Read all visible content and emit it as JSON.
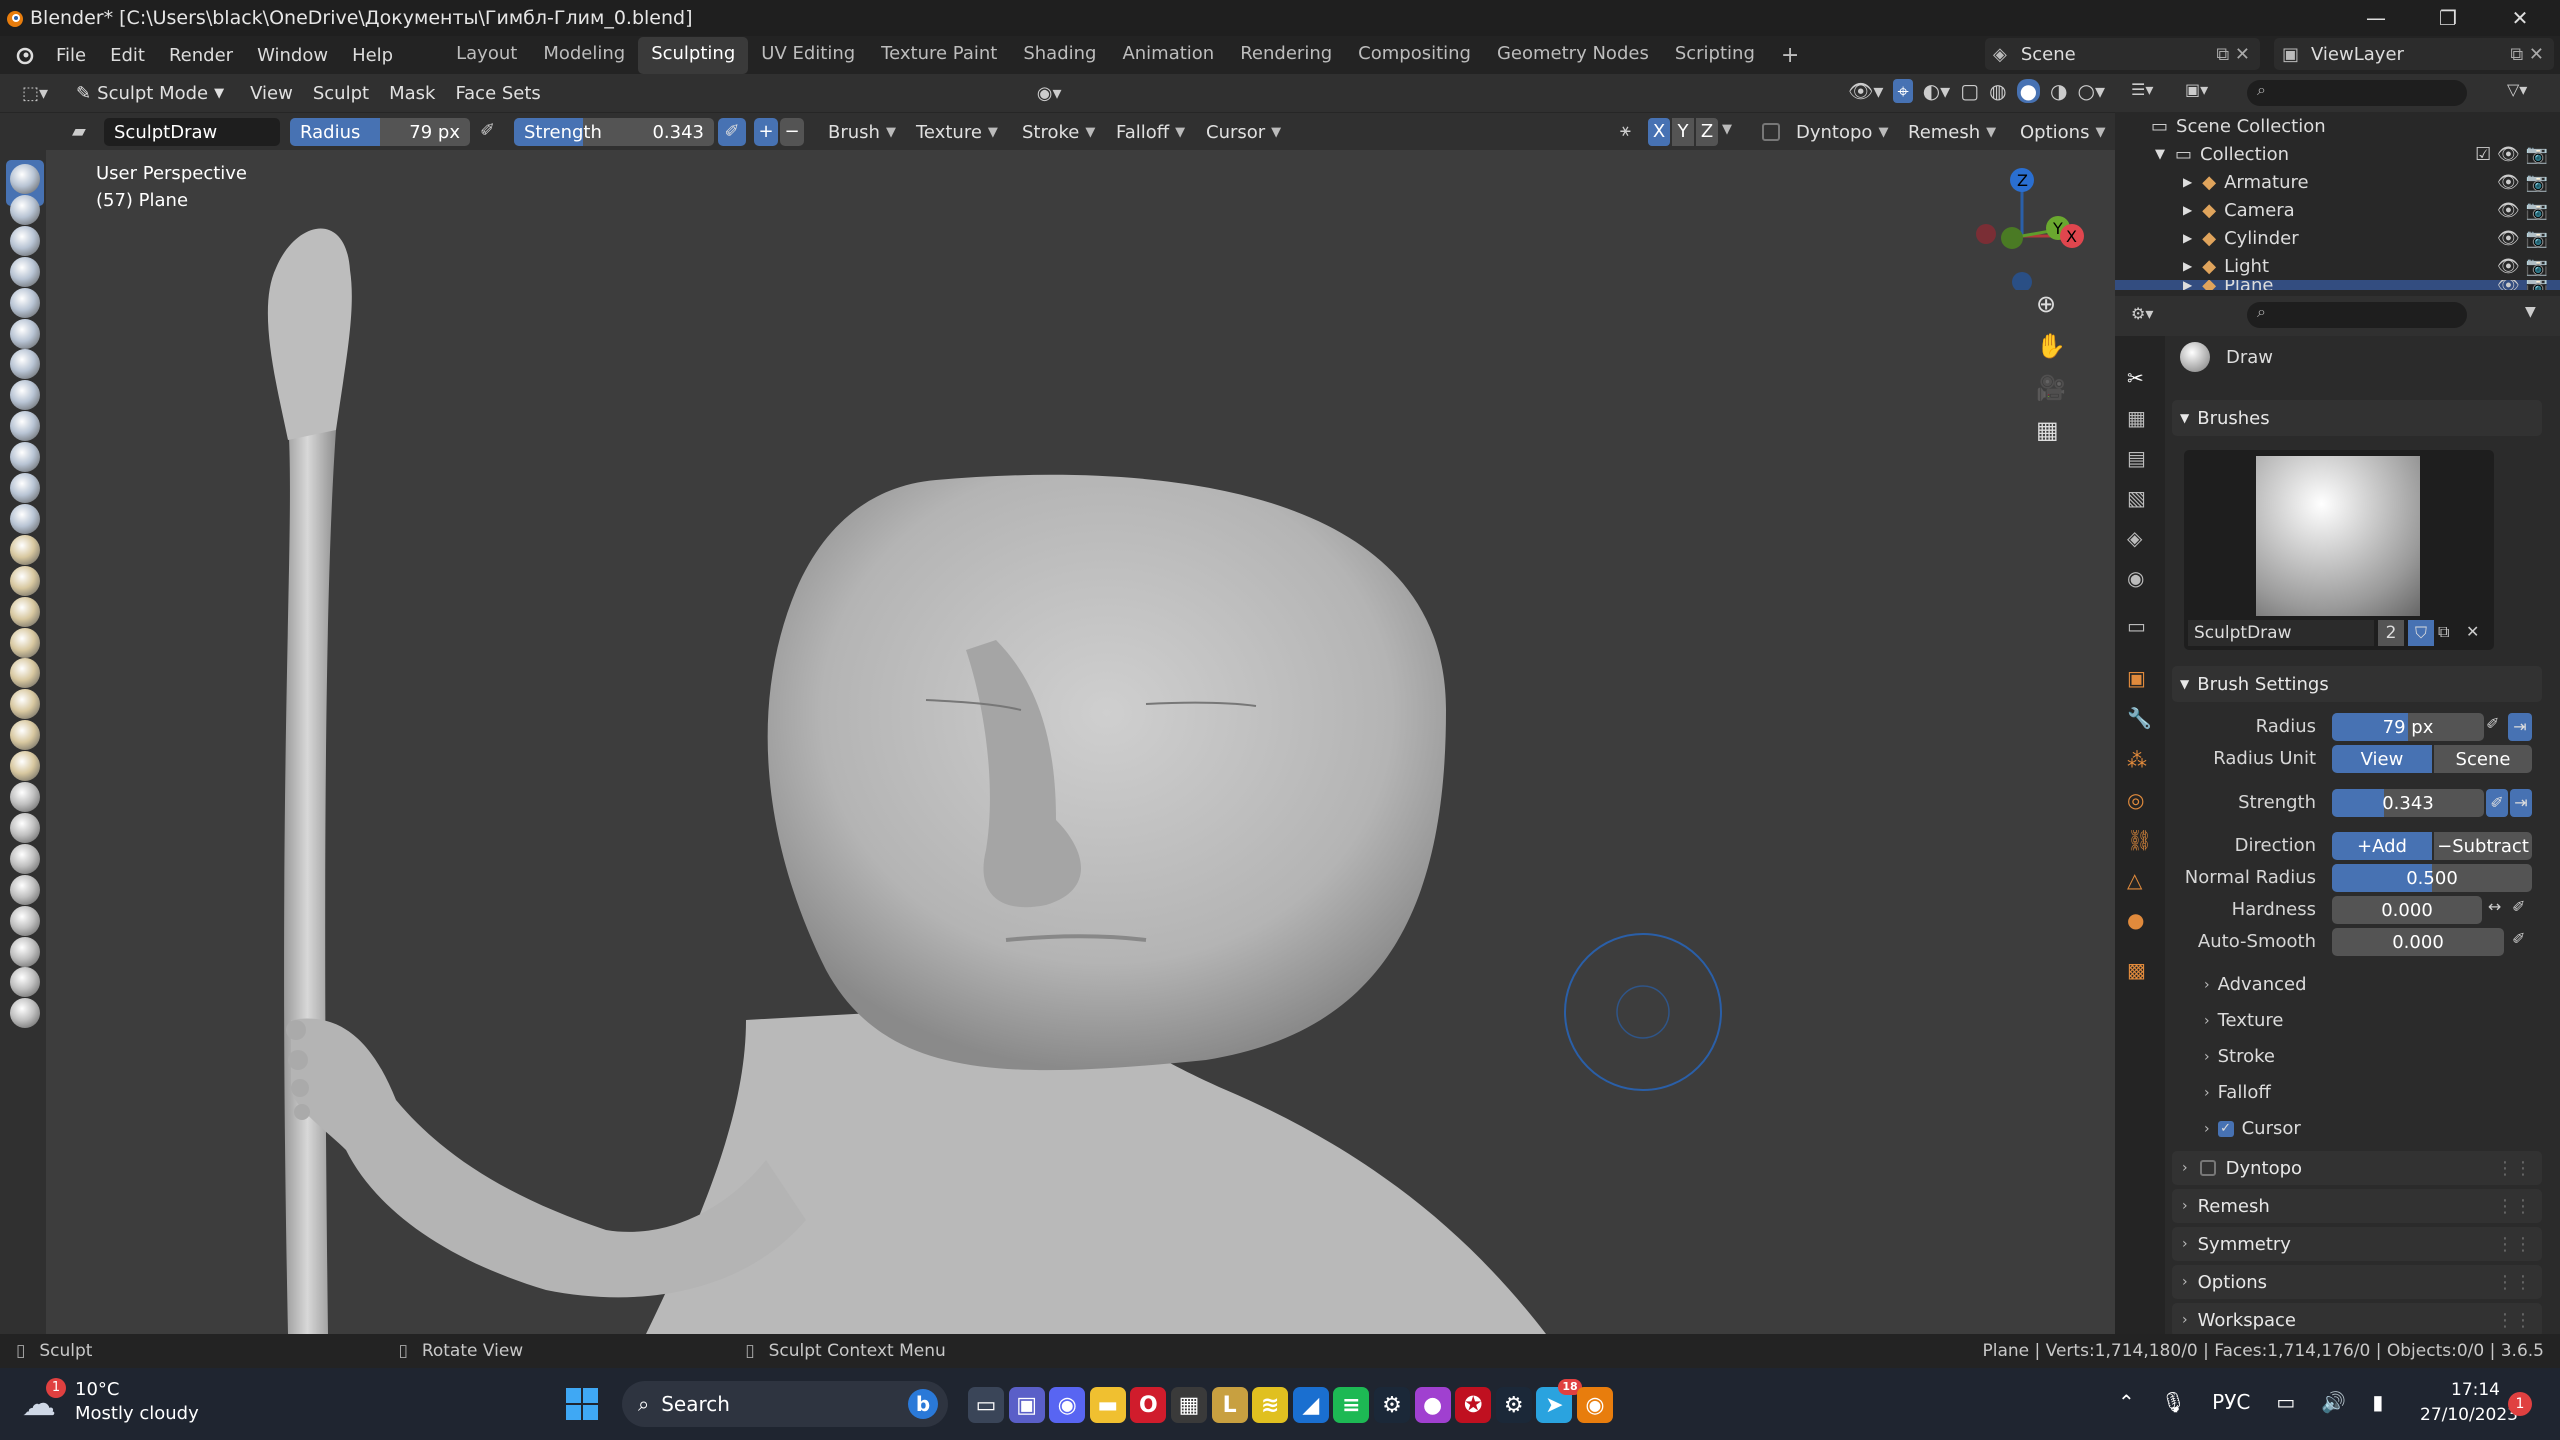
{
  "window": {
    "title": "Blender* [C:\\Users\\black\\OneDrive\\Документы\\Гимбл-Глим_0.blend]",
    "minimize": "—",
    "maximize": "❐",
    "close": "✕"
  },
  "menu": [
    "File",
    "Edit",
    "Render",
    "Window",
    "Help"
  ],
  "workspaces": [
    {
      "label": "Layout"
    },
    {
      "label": "Modeling"
    },
    {
      "label": "Sculpting",
      "active": true
    },
    {
      "label": "UV Editing"
    },
    {
      "label": "Texture Paint"
    },
    {
      "label": "Shading"
    },
    {
      "label": "Animation"
    },
    {
      "label": "Rendering"
    },
    {
      "label": "Compositing"
    },
    {
      "label": "Geometry Nodes"
    },
    {
      "label": "Scripting"
    }
  ],
  "add_workspace": "+",
  "scene": "Scene",
  "view_layer": "ViewLayer",
  "viewport_header": {
    "mode": "Sculpt Mode",
    "menus": [
      "View",
      "Sculpt",
      "Mask",
      "Face Sets"
    ]
  },
  "tool_header": {
    "brush_name": "SculptDraw",
    "radius_label": "Radius",
    "radius_value": "79 px",
    "radius_fill": 0.5,
    "strength_label": "Strength",
    "strength_value": "0.343",
    "strength_fill": 0.343,
    "plus": "+",
    "minus": "−",
    "dropdowns": [
      "Brush",
      "Texture",
      "Stroke",
      "Falloff",
      "Cursor"
    ],
    "axes": [
      "X",
      "Y",
      "Z"
    ],
    "right_dropdowns": [
      "Dyntopo",
      "Remesh",
      "Options"
    ]
  },
  "viewport": {
    "view_name": "User Perspective",
    "object_info": "(57) Plane",
    "bg": "#3d3d3d"
  },
  "gizmo": {
    "z": "Z",
    "y": "Y",
    "x": "X"
  },
  "outliner": {
    "root": "Scene Collection",
    "collection": "Collection",
    "items": [
      {
        "label": "Armature",
        "icon": "armature-icon"
      },
      {
        "label": "Camera",
        "icon": "camera-icon"
      },
      {
        "label": "Cylinder",
        "icon": "mesh-icon"
      },
      {
        "label": "Light",
        "icon": "light-icon"
      },
      {
        "label": "Plane",
        "icon": "mesh-icon"
      }
    ]
  },
  "properties": {
    "tool_title": "Draw",
    "brushes_header": "Brushes",
    "brush_name": "SculptDraw",
    "brush_users": "2",
    "brush_settings_header": "Brush Settings",
    "radius_label": "Radius",
    "radius_value": "79 px",
    "radius_fill": 0.5,
    "radius_unit_label": "Radius Unit",
    "radius_unit_view": "View",
    "radius_unit_scene": "Scene",
    "strength_label": "Strength",
    "strength_value": "0.343",
    "strength_fill": 0.343,
    "direction_label": "Direction",
    "direction_add": "Add",
    "direction_subtract": "Subtract",
    "normal_radius_label": "Normal Radius",
    "normal_radius_value": "0.500",
    "normal_radius_fill": 0.5,
    "hardness_label": "Hardness",
    "hardness_value": "0.000",
    "autosmooth_label": "Auto-Smooth",
    "autosmooth_value": "0.000",
    "subpanels": [
      "Advanced",
      "Texture",
      "Stroke",
      "Falloff",
      "Cursor"
    ],
    "cursor_checked": true,
    "sections": [
      "Dyntopo",
      "Remesh",
      "Symmetry",
      "Options",
      "Workspace"
    ]
  },
  "status": {
    "left": "Sculpt",
    "mid": "Rotate View",
    "right": "Sculpt Context Menu",
    "stats": "Plane | Verts:1,714,180/0 | Faces:1,714,176/0 | Objects:0/0 | 3.6.5"
  },
  "taskbar": {
    "weather_temp": "10°C",
    "weather_desc": "Mostly cloudy",
    "weather_badge": "1",
    "search": "Search",
    "lang": "РУС",
    "time": "17:14",
    "date": "27/10/2023",
    "notif": "1",
    "telegram_badge": "18"
  }
}
